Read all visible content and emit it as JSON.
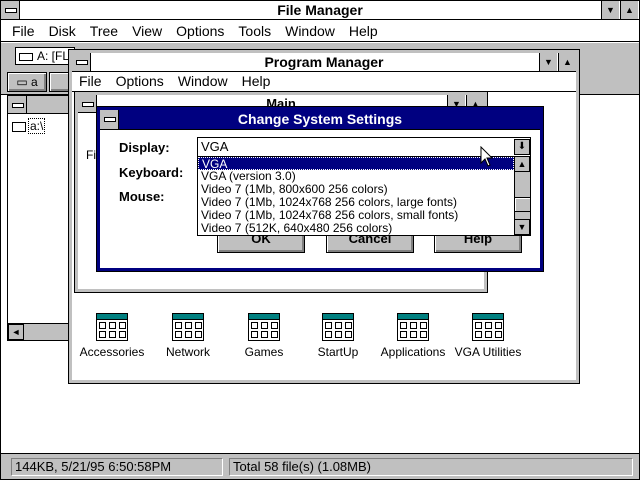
{
  "file_manager": {
    "title": "File Manager",
    "menu": [
      "File",
      "Disk",
      "Tree",
      "View",
      "Options",
      "Tools",
      "Window",
      "Help"
    ],
    "drive_label": "A: [FL",
    "tree_root": "a:\\",
    "status_left": "144KB, 5/21/95 6:50:58PM",
    "status_right": "Total 58 file(s) (1.08MB)",
    "partial_label": "Fil"
  },
  "program_manager": {
    "title": "Program Manager",
    "menu": [
      "File",
      "Options",
      "Window",
      "Help"
    ],
    "main_group_title": "Main",
    "groups": [
      {
        "label": "Accessories",
        "icon": "program-group-icon"
      },
      {
        "label": "Network",
        "icon": "program-group-icon"
      },
      {
        "label": "Games",
        "icon": "program-group-icon"
      },
      {
        "label": "StartUp",
        "icon": "program-group-icon"
      },
      {
        "label": "Applications",
        "icon": "program-group-icon"
      },
      {
        "label": "VGA Utilities",
        "icon": "program-group-icon"
      }
    ]
  },
  "dialog": {
    "title": "Change System Settings",
    "display_label": "Display:",
    "keyboard_label": "Keyboard:",
    "mouse_label": "Mouse:",
    "display_value": "VGA",
    "options": [
      "VGA",
      "VGA (version 3.0)",
      "Video 7 (1Mb,  800x600 256 colors)",
      "Video 7 (1Mb, 1024x768 256 colors, large fonts)",
      "Video 7 (1Mb, 1024x768 256 colors, small fonts)",
      "Video 7 (512K, 640x480 256 colors)"
    ],
    "selected_index": 0,
    "ok_label": "OK",
    "cancel_label": "Cancel",
    "help_label": "Help"
  },
  "colors": {
    "active_title": "#000080",
    "face": "#c0c0c0",
    "group_icon_accent": "#008080"
  }
}
